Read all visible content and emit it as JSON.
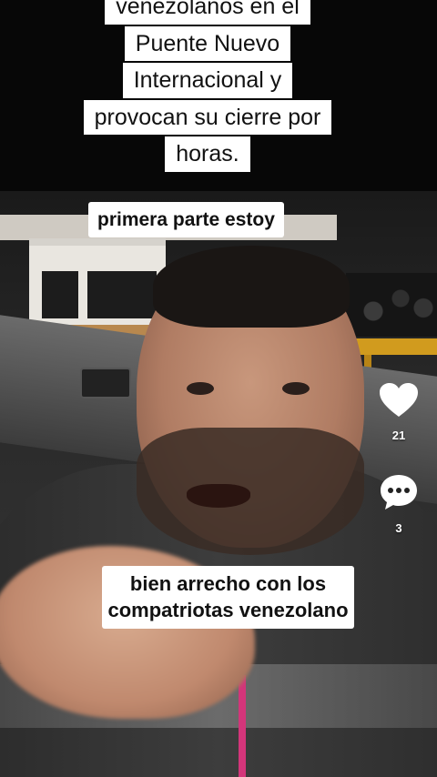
{
  "title_caption": {
    "lines": [
      "venezolanos en el",
      "Puente Nuevo",
      "Internacional y",
      "provocan su cierre por",
      "horas."
    ]
  },
  "captions": {
    "top": "primera parte estoy",
    "bottom": "bien arrecho con los compatriotas venezolano"
  },
  "actions": {
    "like": {
      "icon": "heart-icon",
      "count": "21"
    },
    "comment": {
      "icon": "comment-bubble-icon",
      "count": "3"
    }
  },
  "colors": {
    "caption_bg": "#ffffff",
    "caption_text": "#111111",
    "icon_color": "#ffffff",
    "accent_zipper": "#d3357a"
  }
}
